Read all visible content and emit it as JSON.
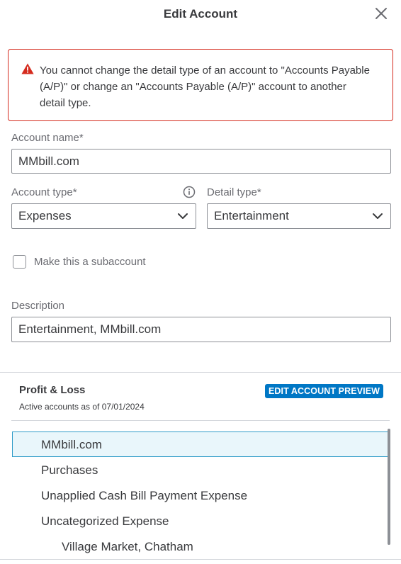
{
  "dialog": {
    "title": "Edit Account",
    "close_icon": "close-icon"
  },
  "alert": {
    "icon": "warning-icon",
    "color": "#d52b1e",
    "message": "You cannot change the detail type of an account to \"Accounts Payable (A/P)\" or change an \"Accounts Payable (A/P)\" account to another detail type."
  },
  "form": {
    "account_name": {
      "label": "Account name*",
      "value": "MMbill.com"
    },
    "account_type": {
      "label": "Account type*",
      "value": "Expenses",
      "icon": "info-icon"
    },
    "detail_type": {
      "label": "Detail type*",
      "value": "Entertainment"
    },
    "subaccount": {
      "label": "Make this a subaccount",
      "checked": false
    },
    "description": {
      "label": "Description",
      "value": "Entertainment, MMbill.com"
    }
  },
  "preview": {
    "title": "Profit & Loss",
    "subtitle": "Active accounts as of 07/01/2024",
    "button_label": "EDIT ACCOUNT PREVIEW",
    "button_color": "#0077c5",
    "items": [
      {
        "label": "MMbill.com",
        "selected": true
      },
      {
        "label": "Purchases"
      },
      {
        "label": "Unapplied Cash Bill Payment Expense"
      },
      {
        "label": "Uncategorized Expense"
      },
      {
        "label": "Village Market, Chatham"
      }
    ]
  }
}
